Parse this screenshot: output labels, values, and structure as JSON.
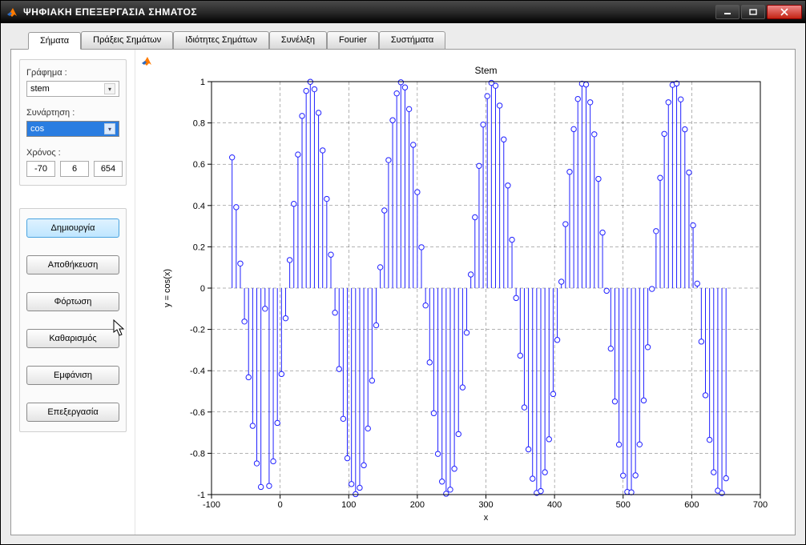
{
  "window": {
    "title": "ΨΗΦΙΑΚΗ ΕΠΕΞΕΡΓΑΣΙΑ ΣΗΜΑΤΟΣ"
  },
  "tabs": [
    {
      "label": "Σήματα",
      "active": true
    },
    {
      "label": "Πράξεις Σημάτων",
      "active": false
    },
    {
      "label": "Ιδιότητες Σημάτων",
      "active": false
    },
    {
      "label": "Συνέλιξη",
      "active": false
    },
    {
      "label": "Fourier",
      "active": false
    },
    {
      "label": "Συστήματα",
      "active": false
    }
  ],
  "sidebar": {
    "graph_label": "Γράφημα :",
    "graph_value": "stem",
    "func_label": "Συνάρτηση :",
    "func_value": "cos",
    "time_label": "Χρόνος :",
    "time_values": [
      "-70",
      "6",
      "654"
    ]
  },
  "buttons": {
    "create": "Δημιουργία",
    "save": "Αποθήκευση",
    "load": "Φόρτωση",
    "clear": "Καθαρισμός",
    "show": "Εμφάνιση",
    "edit": "Επεξεργασία"
  },
  "chart_data": {
    "type": "bar",
    "title": "Stem",
    "xlabel": "x",
    "ylabel": "y = cos(x)",
    "xlim": [
      -100,
      700
    ],
    "ylim": [
      -1,
      1
    ],
    "xticks": [
      -100,
      0,
      100,
      200,
      300,
      400,
      500,
      600,
      700
    ],
    "yticks": [
      -1,
      -0.8,
      -0.6,
      -0.4,
      -0.2,
      0,
      0.2,
      0.4,
      0.6,
      0.8,
      1
    ],
    "x": [
      -70,
      -64,
      -58,
      -52,
      -46,
      -40,
      -34,
      -28,
      -22,
      -16,
      -10,
      -4,
      2,
      8,
      14,
      20,
      26,
      32,
      38,
      44,
      50,
      56,
      62,
      68,
      74,
      80,
      86,
      92,
      98,
      104,
      110,
      116,
      122,
      128,
      134,
      140,
      146,
      152,
      158,
      164,
      170,
      176,
      182,
      188,
      194,
      200,
      206,
      212,
      218,
      224,
      230,
      236,
      242,
      248,
      254,
      260,
      266,
      272,
      278,
      284,
      290,
      296,
      302,
      308,
      314,
      320,
      326,
      332,
      338,
      344,
      350,
      356,
      362,
      368,
      374,
      380,
      386,
      392,
      398,
      404,
      410,
      416,
      422,
      428,
      434,
      440,
      446,
      452,
      458,
      464,
      470,
      476,
      482,
      488,
      494,
      500,
      506,
      512,
      518,
      524,
      530,
      536,
      542,
      548,
      554,
      560,
      566,
      572,
      578,
      584,
      590,
      596,
      602,
      608,
      614,
      620,
      626,
      632,
      638,
      644,
      650
    ],
    "values": [
      0.633,
      0.392,
      0.119,
      -0.162,
      -0.432,
      -0.667,
      -0.849,
      -0.963,
      -0.1,
      -0.958,
      -0.839,
      -0.653,
      -0.416,
      -0.146,
      0.136,
      0.408,
      0.647,
      0.834,
      0.955,
      0.999,
      0.963,
      0.849,
      0.667,
      0.432,
      0.162,
      -0.119,
      -0.392,
      -0.633,
      -0.824,
      -0.949,
      -0.998,
      -0.967,
      -0.858,
      -0.68,
      -0.448,
      -0.18,
      0.101,
      0.376,
      0.62,
      0.813,
      0.943,
      0.997,
      0.972,
      0.867,
      0.694,
      0.465,
      0.198,
      -0.084,
      -0.36,
      -0.606,
      -0.803,
      -0.937,
      -0.996,
      -0.976,
      -0.875,
      -0.707,
      -0.481,
      -0.216,
      0.066,
      0.343,
      0.592,
      0.792,
      0.93,
      0.994,
      0.98,
      0.884,
      0.72,
      0.497,
      0.234,
      -0.048,
      -0.327,
      -0.578,
      -0.781,
      -0.923,
      -0.992,
      -0.983,
      -0.892,
      -0.732,
      -0.513,
      -0.251,
      0.031,
      0.31,
      0.563,
      0.77,
      0.916,
      0.99,
      0.986,
      0.9,
      0.745,
      0.529,
      0.269,
      -0.013,
      -0.293,
      -0.549,
      -0.758,
      -0.908,
      -0.987,
      -0.989,
      -0.907,
      -0.757,
      -0.544,
      -0.286,
      -0.004,
      0.276,
      0.534,
      0.747,
      0.9,
      0.984,
      0.991,
      0.914,
      0.769,
      0.56,
      0.304,
      0.022,
      -0.259,
      -0.519,
      -0.735,
      -0.892,
      -0.981,
      -0.993,
      -0.921
    ],
    "color": "#2020ff"
  }
}
